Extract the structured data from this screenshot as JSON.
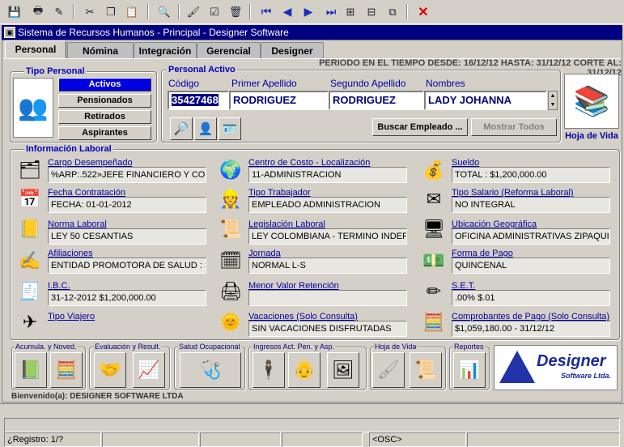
{
  "window": {
    "title": "Sistema de Recursos Humanos - Principal - Designer Software"
  },
  "toolbar": {
    "icons": [
      "save-icon",
      "print-icon",
      "edit-icon",
      "cut-icon",
      "copy-icon",
      "paste-icon",
      "zoom-icon",
      "clear-icon",
      "checklist-icon",
      "delete-record-icon",
      "first-record-icon",
      "prev-record-icon",
      "next-record-icon",
      "last-record-icon",
      "insert-record-icon",
      "remove-record-icon",
      "duplicate-record-icon",
      "exit-icon"
    ]
  },
  "tabs": [
    "Personal",
    "Nómina",
    "Integración",
    "Gerencial",
    "Designer"
  ],
  "period": "PERIODO EN EL TIEMPO DESDE: 16/12/12 HASTA: 31/12/12 CORTE AL: 31/12/12",
  "tipo_personal": {
    "label": "Tipo Personal",
    "buttons": [
      "Activos",
      "Pensionados",
      "Retirados",
      "Aspirantes"
    ],
    "selected": "Activos"
  },
  "personal_activo": {
    "label": "Personal Activo",
    "headers": {
      "codigo": "Código",
      "primer_apellido": "Primer Apellido",
      "segundo_apellido": "Segundo Apellido",
      "nombres": "Nombres"
    },
    "codigo": "35427468",
    "primer_apellido": "RODRIGUEZ",
    "segundo_apellido": "RODRIGUEZ",
    "nombres": "LADY JOHANNA",
    "buscar": "Buscar Empleado ...",
    "mostrar": "Mostrar Todos",
    "hoja_vida": "Hoja de Vida"
  },
  "info_laboral": {
    "label": "Información Laboral",
    "col1": [
      {
        "label": "Cargo Desempeñado",
        "value": "%ARP:.522»JEFE FINANCIERO Y CONTA"
      },
      {
        "label": "Fecha Contratación",
        "value": "FECHA: 01-01-2012"
      },
      {
        "label": "Norma Laboral",
        "value": "LEY 50 CESANTIAS"
      },
      {
        "label": "Afiliaciones",
        "value": "ENTIDAD PROMOTORA DE SALUD : SAl"
      },
      {
        "label": "I.B.C.",
        "value": "31-12-2012    $1,200,000.00"
      },
      {
        "label": "Tipo Viajero",
        "value": ""
      }
    ],
    "col2": [
      {
        "label": "Centro de Costo - Localización",
        "value": "11-ADMINISTRACION"
      },
      {
        "label": "Tipo Trabajador",
        "value": "EMPLEADO ADMINISTRACION"
      },
      {
        "label": "Legislación Laboral",
        "value": "LEY COLOMBIANA - TERMINO INDEFINID"
      },
      {
        "label": "Jornada",
        "value": "NORMAL L-S"
      },
      {
        "label": "Menor Valor Retención",
        "value": ""
      },
      {
        "label": "Vacaciones (Solo Consulta)",
        "value": "SIN VACACIONES DISFRUTADAS"
      }
    ],
    "col3": [
      {
        "label": "Sueldo",
        "value": "TOTAL :     $1,200,000.00"
      },
      {
        "label": "Tipo Salario (Reforma Laboral)",
        "value": "NO INTEGRAL"
      },
      {
        "label": "Ubicación Geográfica",
        "value": "OFICINA ADMINISTRATIVAS ZIPAQUIRA"
      },
      {
        "label": "Forma de Pago",
        "value": "QUINCENAL"
      },
      {
        "label": "S.E.T.",
        "value": "    .00%            $.01"
      },
      {
        "label": "Comprobantes de Pago (Solo Consulta)",
        "value": "   $1,059,180.00 - 31/12/12"
      }
    ]
  },
  "modules": [
    {
      "label": "Acumula.  y Noved."
    },
    {
      "label": "Evaluación y Result."
    },
    {
      "label": "Salud Ocupacional"
    },
    {
      "label": "Ingresos Act. Pen. y Asp."
    },
    {
      "label": "Hoja de Vida"
    },
    {
      "label": "Reportes"
    }
  ],
  "logo": {
    "brand": "Designer",
    "sub": "Software Ltda."
  },
  "welcome": "Bienvenido(a): DESIGNER SOFTWARE LTDA",
  "status": {
    "registro": "¿Registro: 1/?",
    "osc": "<OSC>"
  },
  "colors": {
    "accent": "#0000e0",
    "title": "#000080",
    "label": "#0000a0",
    "background": "#d4d0c8"
  }
}
